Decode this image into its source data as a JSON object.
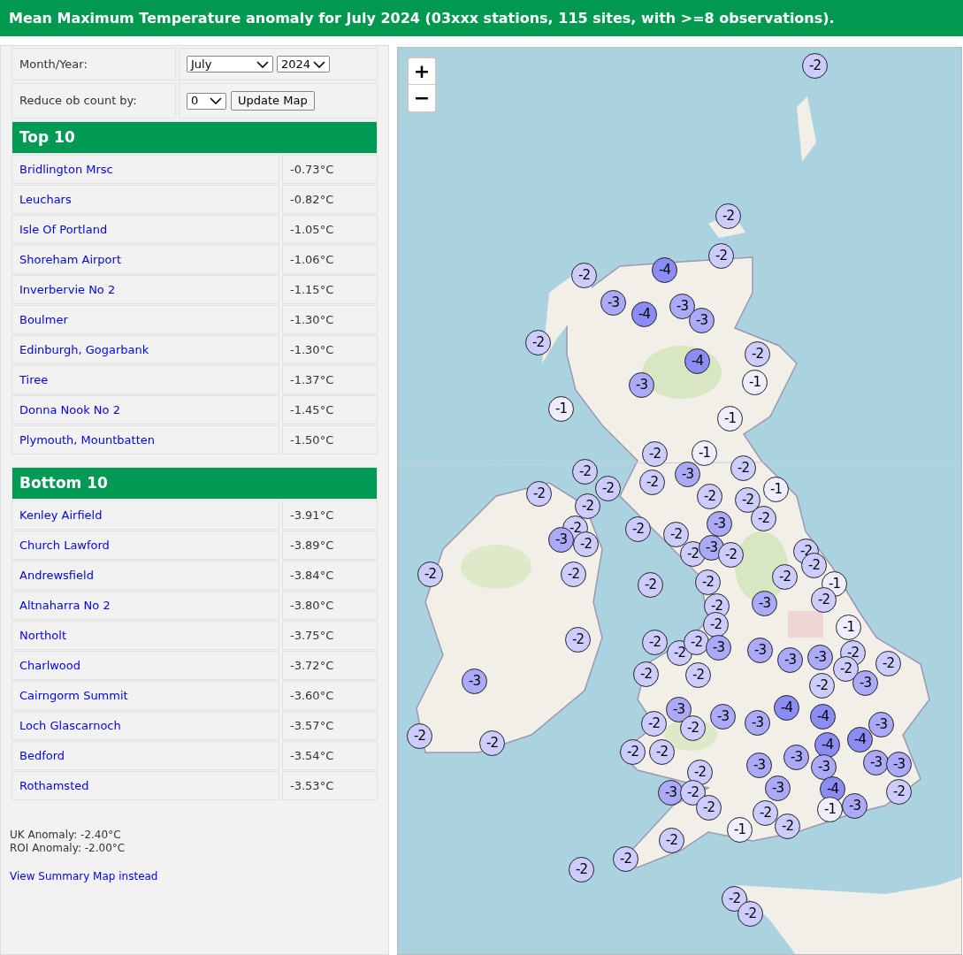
{
  "title": "Mean Maximum Temperature anomaly for July 2024 (03xxx stations, 115 sites, with >=8 observations).",
  "form": {
    "month_label": "Month/Year:",
    "month": "July",
    "year": "2024",
    "reduce_label": "Reduce ob count by:",
    "reduce": "0",
    "update_button": "Update Map"
  },
  "top10": {
    "heading": "Top 10",
    "rows": [
      {
        "station": "Bridlington Mrsc",
        "anomaly": "-0.73°C"
      },
      {
        "station": "Leuchars",
        "anomaly": "-0.82°C"
      },
      {
        "station": "Isle Of Portland",
        "anomaly": "-1.05°C"
      },
      {
        "station": "Shoreham Airport",
        "anomaly": "-1.06°C"
      },
      {
        "station": "Inverbervie No 2",
        "anomaly": "-1.15°C"
      },
      {
        "station": "Boulmer",
        "anomaly": "-1.30°C"
      },
      {
        "station": "Edinburgh, Gogarbank",
        "anomaly": "-1.30°C"
      },
      {
        "station": "Tiree",
        "anomaly": "-1.37°C"
      },
      {
        "station": "Donna Nook No 2",
        "anomaly": "-1.45°C"
      },
      {
        "station": "Plymouth, Mountbatten",
        "anomaly": "-1.50°C"
      }
    ]
  },
  "bottom10": {
    "heading": "Bottom 10",
    "rows": [
      {
        "station": "Kenley Airfield",
        "anomaly": "-3.91°C"
      },
      {
        "station": "Church Lawford",
        "anomaly": "-3.89°C"
      },
      {
        "station": "Andrewsfield",
        "anomaly": "-3.84°C"
      },
      {
        "station": "Altnaharra No 2",
        "anomaly": "-3.80°C"
      },
      {
        "station": "Northolt",
        "anomaly": "-3.75°C"
      },
      {
        "station": "Charlwood",
        "anomaly": "-3.72°C"
      },
      {
        "station": "Cairngorm Summit",
        "anomaly": "-3.60°C"
      },
      {
        "station": "Loch Glascarnoch",
        "anomaly": "-3.57°C"
      },
      {
        "station": "Bedford",
        "anomaly": "-3.54°C"
      },
      {
        "station": "Rothamsted",
        "anomaly": "-3.53°C"
      }
    ]
  },
  "summary": [
    "UK Anomaly: -2.40°C",
    "ROI Anomaly: -2.00°C"
  ],
  "summary_link": "View Summary Map instead",
  "map": {
    "zoom_in": "+",
    "zoom_out": "−",
    "markers": [
      {
        "label": "-2",
        "color": "#ccccff"
      },
      {
        "label": "-2",
        "color": "#ccccff"
      },
      {
        "label": "-2",
        "color": "#ccccff"
      },
      {
        "label": "-2",
        "color": "#ccccff"
      },
      {
        "label": "-4",
        "color": "#8c8cf5"
      },
      {
        "label": "-3",
        "color": "#aaaaf8"
      },
      {
        "label": "-4",
        "color": "#8c8cf5"
      },
      {
        "label": "-3",
        "color": "#aaaaf8"
      },
      {
        "label": "-3",
        "color": "#aaaaf8"
      },
      {
        "label": "-2",
        "color": "#ccccff"
      },
      {
        "label": "-4",
        "color": "#8c8cf5"
      },
      {
        "label": "-2",
        "color": "#ccccff"
      },
      {
        "label": "-3",
        "color": "#aaaaf8"
      },
      {
        "label": "-1",
        "color": "#eeeeff"
      },
      {
        "label": "-1",
        "color": "#eeeeff"
      },
      {
        "label": "-1",
        "color": "#eeeeff"
      },
      {
        "label": "-2",
        "color": "#ccccff"
      },
      {
        "label": "-1",
        "color": "#eeeeff"
      },
      {
        "label": "-2",
        "color": "#ccccff"
      },
      {
        "label": "-3",
        "color": "#aaaaf8"
      },
      {
        "label": "-2",
        "color": "#ccccff"
      },
      {
        "label": "-2",
        "color": "#ccccff"
      },
      {
        "label": "-2",
        "color": "#ccccff"
      },
      {
        "label": "-2",
        "color": "#ccccff"
      },
      {
        "label": "-2",
        "color": "#ccccff"
      },
      {
        "label": "-2",
        "color": "#ccccff"
      },
      {
        "label": "-1",
        "color": "#eeeeff"
      },
      {
        "label": "-2",
        "color": "#ccccff"
      },
      {
        "label": "-2",
        "color": "#ccccff"
      },
      {
        "label": "-2",
        "color": "#ccccff"
      },
      {
        "label": "-2",
        "color": "#ccccff"
      },
      {
        "label": "-3",
        "color": "#aaaaf8"
      },
      {
        "label": "-2",
        "color": "#ccccff"
      },
      {
        "label": "-3",
        "color": "#aaaaf8"
      },
      {
        "label": "-2",
        "color": "#ccccff"
      },
      {
        "label": "-2",
        "color": "#ccccff"
      },
      {
        "label": "-3",
        "color": "#aaaaf8"
      },
      {
        "label": "-2",
        "color": "#ccccff"
      },
      {
        "label": "-2",
        "color": "#ccccff"
      },
      {
        "label": "-2",
        "color": "#ccccff"
      },
      {
        "label": "-2",
        "color": "#ccccff"
      },
      {
        "label": "-2",
        "color": "#ccccff"
      },
      {
        "label": "-2",
        "color": "#ccccff"
      },
      {
        "label": "-2",
        "color": "#ccccff"
      },
      {
        "label": "-2",
        "color": "#ccccff"
      },
      {
        "label": "-1",
        "color": "#eeeeff"
      },
      {
        "label": "-2",
        "color": "#ccccff"
      },
      {
        "label": "-3",
        "color": "#aaaaf8"
      },
      {
        "label": "-2",
        "color": "#ccccff"
      },
      {
        "label": "-2",
        "color": "#ccccff"
      },
      {
        "label": "-1",
        "color": "#eeeeff"
      },
      {
        "label": "-2",
        "color": "#ccccff"
      },
      {
        "label": "-2",
        "color": "#ccccff"
      },
      {
        "label": "-2",
        "color": "#ccccff"
      },
      {
        "label": "-2",
        "color": "#ccccff"
      },
      {
        "label": "-3",
        "color": "#aaaaf8"
      },
      {
        "label": "-3",
        "color": "#aaaaf8"
      },
      {
        "label": "-3",
        "color": "#aaaaf8"
      },
      {
        "label": "-3",
        "color": "#aaaaf8"
      },
      {
        "label": "-2",
        "color": "#ccccff"
      },
      {
        "label": "-2",
        "color": "#ccccff"
      },
      {
        "label": "-3",
        "color": "#aaaaf8"
      },
      {
        "label": "-2",
        "color": "#ccccff"
      },
      {
        "label": "-2",
        "color": "#ccccff"
      },
      {
        "label": "-2",
        "color": "#ccccff"
      },
      {
        "label": "-2",
        "color": "#ccccff"
      },
      {
        "label": "-3",
        "color": "#aaaaf8"
      },
      {
        "label": "-2",
        "color": "#ccccff"
      },
      {
        "label": "-3",
        "color": "#aaaaf8"
      },
      {
        "label": "-2",
        "color": "#ccccff"
      },
      {
        "label": "-3",
        "color": "#aaaaf8"
      },
      {
        "label": "-3",
        "color": "#aaaaf8"
      },
      {
        "label": "-4",
        "color": "#8c8cf5"
      },
      {
        "label": "-4",
        "color": "#8c8cf5"
      },
      {
        "label": "-3",
        "color": "#aaaaf8"
      },
      {
        "label": "-2",
        "color": "#ccccff"
      },
      {
        "label": "-2",
        "color": "#ccccff"
      },
      {
        "label": "-4",
        "color": "#8c8cf5"
      },
      {
        "label": "-4",
        "color": "#8c8cf5"
      },
      {
        "label": "-2",
        "color": "#ccccff"
      },
      {
        "label": "-2",
        "color": "#ccccff"
      },
      {
        "label": "-2",
        "color": "#ccccff"
      },
      {
        "label": "-3",
        "color": "#aaaaf8"
      },
      {
        "label": "-3",
        "color": "#aaaaf8"
      },
      {
        "label": "-3",
        "color": "#aaaaf8"
      },
      {
        "label": "-3",
        "color": "#aaaaf8"
      },
      {
        "label": "-3",
        "color": "#aaaaf8"
      },
      {
        "label": "-3",
        "color": "#aaaaf8"
      },
      {
        "label": "-2",
        "color": "#ccccff"
      },
      {
        "label": "-3",
        "color": "#aaaaf8"
      },
      {
        "label": "-4",
        "color": "#8c8cf5"
      },
      {
        "label": "-2",
        "color": "#ccccff"
      },
      {
        "label": "-2",
        "color": "#ccccff"
      },
      {
        "label": "-2",
        "color": "#ccccff"
      },
      {
        "label": "-1",
        "color": "#eeeeff"
      },
      {
        "label": "-3",
        "color": "#aaaaf8"
      },
      {
        "label": "-1",
        "color": "#eeeeff"
      },
      {
        "label": "-2",
        "color": "#ccccff"
      },
      {
        "label": "-2",
        "color": "#ccccff"
      },
      {
        "label": "-2",
        "color": "#ccccff"
      },
      {
        "label": "-2",
        "color": "#ccccff"
      },
      {
        "label": "-2",
        "color": "#ccccff"
      },
      {
        "label": "-2",
        "color": "#ccccff"
      }
    ]
  }
}
